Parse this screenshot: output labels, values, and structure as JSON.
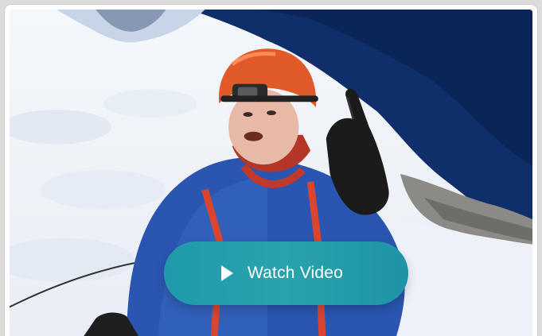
{
  "video_card": {
    "button_label": "Watch Video",
    "play_icon": "play-icon",
    "thumbnail_subject": "mountain-climber-selfie"
  },
  "colors": {
    "button": "#2299aa",
    "helmet": "#e05a2a",
    "jacket": "#2a55b0",
    "sky": "#0d2d66",
    "snow": "#f4f7fb"
  }
}
